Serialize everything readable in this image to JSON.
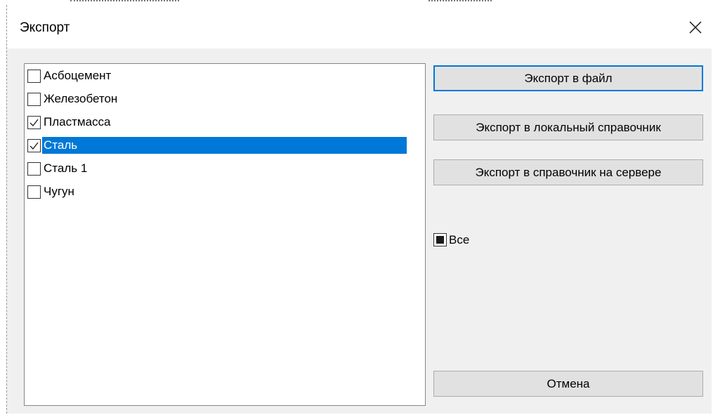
{
  "window": {
    "title": "Экспорт"
  },
  "materials": [
    {
      "label": "Асбоцемент",
      "checked": false,
      "selected": false
    },
    {
      "label": "Железобетон",
      "checked": false,
      "selected": false
    },
    {
      "label": "Пластмасса",
      "checked": true,
      "selected": false
    },
    {
      "label": "Сталь",
      "checked": true,
      "selected": true
    },
    {
      "label": "Сталь 1",
      "checked": false,
      "selected": false
    },
    {
      "label": "Чугун",
      "checked": false,
      "selected": false
    }
  ],
  "buttons": {
    "export_file": "Экспорт в файл",
    "export_local": "Экспорт в локальный справочник",
    "export_server": "Экспорт в справочник на сервере",
    "cancel": "Отмена"
  },
  "select_all": {
    "label": "Все",
    "state": "indeterminate"
  },
  "icons": {
    "close": "close-icon",
    "check": "checkmark-icon"
  },
  "colors": {
    "selection": "#0078d7",
    "dialog_bg": "#f0f0f0",
    "button_bg": "#e1e1e1"
  }
}
